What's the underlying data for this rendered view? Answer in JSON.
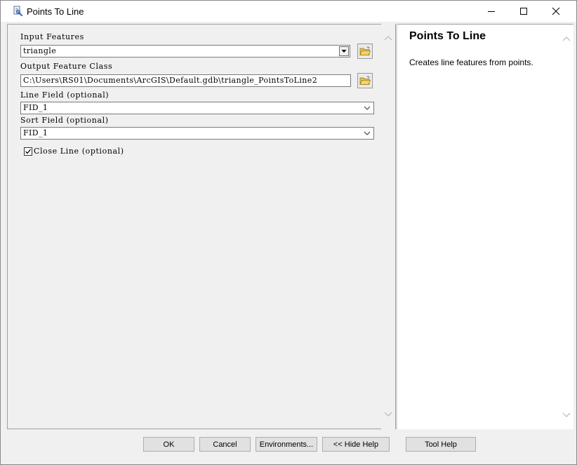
{
  "window": {
    "title": "Points To Line"
  },
  "params": {
    "input_features": {
      "label": "Input Features",
      "value": "triangle"
    },
    "output_feature_class": {
      "label": "Output Feature Class",
      "value": "C:\\Users\\RS01\\Documents\\ArcGIS\\Default.gdb\\triangle_PointsToLine2"
    },
    "line_field": {
      "label": "Line Field (optional)",
      "value": "FID_1"
    },
    "sort_field": {
      "label": "Sort Field (optional)",
      "value": "FID_1"
    },
    "close_line": {
      "label": "Close Line (optional)",
      "checked": true
    }
  },
  "help": {
    "title": "Points To Line",
    "description": "Creates line features from points."
  },
  "buttons": {
    "ok": "OK",
    "cancel": "Cancel",
    "environments": "Environments...",
    "hide_help": "<< Hide Help",
    "tool_help": "Tool Help"
  }
}
